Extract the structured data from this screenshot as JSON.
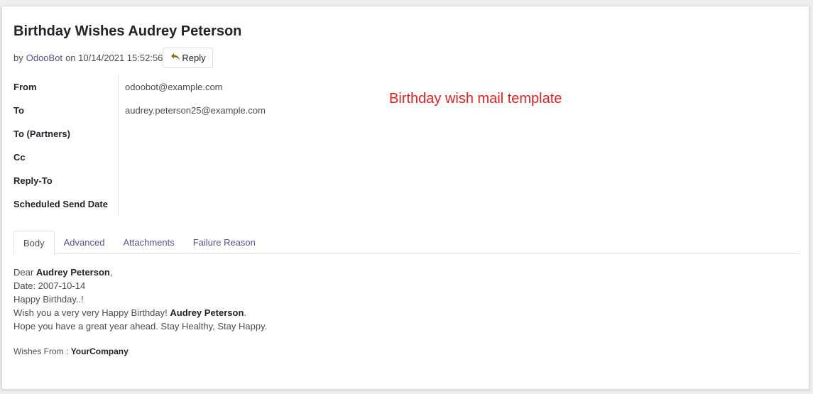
{
  "message": {
    "title": "Birthday Wishes Audrey Peterson",
    "by_prefix": "by",
    "author": "OdooBot",
    "date_text": "on 10/14/2021 15:52:56",
    "reply_label": "Reply"
  },
  "fields": [
    {
      "label": "From",
      "value": "odoobot@example.com"
    },
    {
      "label": "To",
      "value": "audrey.peterson25@example.com"
    },
    {
      "label": "To (Partners)",
      "value": ""
    },
    {
      "label": "Cc",
      "value": ""
    },
    {
      "label": "Reply-To",
      "value": ""
    },
    {
      "label": "Scheduled Send Date",
      "value": ""
    }
  ],
  "annotation": "Birthday wish mail template",
  "tabs": [
    "Body",
    "Advanced",
    "Attachments",
    "Failure Reason"
  ],
  "active_tab": "Body",
  "body": {
    "greeting_prefix": "Dear",
    "name": "Audrey Peterson",
    "greeting_suffix": ",",
    "date_line": "Date: 2007-10-14",
    "line1": "Happy Birthday..!",
    "wish_prefix": "Wish you a very very Happy Birthday!",
    "wish_suffix": ".",
    "line3": "Hope you have a great year ahead. Stay Healthy, Stay Happy.",
    "wishes_prefix": "Wishes From :",
    "company": "YourCompany"
  },
  "colors": {
    "link": "#5a4f8e",
    "annotation": "#e52020",
    "reply_icon": "#8a6d1f"
  }
}
